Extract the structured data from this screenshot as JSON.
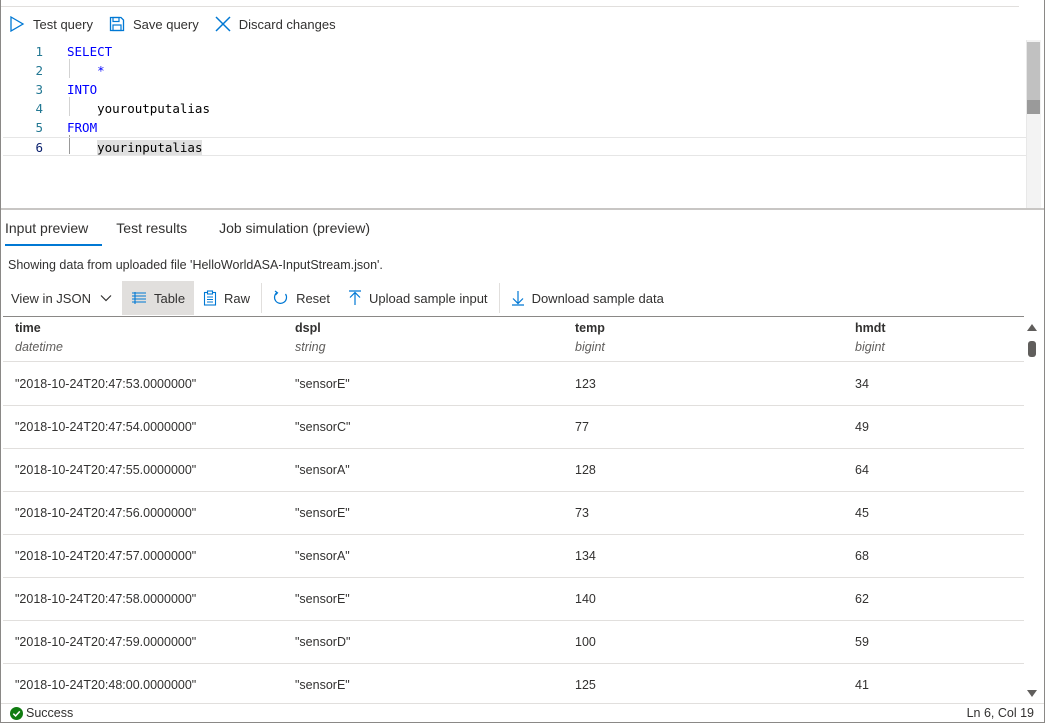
{
  "toolbar": {
    "test_query": "Test query",
    "save_query": "Save query",
    "discard_changes": "Discard changes"
  },
  "editor": {
    "lines": [
      {
        "num": "1",
        "text": "SELECT"
      },
      {
        "num": "2",
        "text": "    *"
      },
      {
        "num": "3",
        "text": "INTO"
      },
      {
        "num": "4",
        "text": "    youroutputalias"
      },
      {
        "num": "5",
        "text": "FROM"
      },
      {
        "num": "6",
        "text": "    yourinputalias"
      }
    ],
    "colors": {
      "keyword": "#0000ff",
      "line_number": "#237893"
    }
  },
  "tabs": [
    {
      "label": "Input preview",
      "active": true
    },
    {
      "label": "Test results",
      "active": false
    },
    {
      "label": "Job simulation (preview)",
      "active": false
    }
  ],
  "info_text": "Showing data from uploaded file 'HelloWorldASA-InputStream.json'.",
  "table_toolbar": {
    "view_select": "View in JSON",
    "table": "Table",
    "raw": "Raw",
    "reset": "Reset",
    "upload": "Upload sample input",
    "download": "Download sample data"
  },
  "grid": {
    "columns": [
      {
        "name": "time",
        "type": "datetime"
      },
      {
        "name": "dspl",
        "type": "string"
      },
      {
        "name": "temp",
        "type": "bigint"
      },
      {
        "name": "hmdt",
        "type": "bigint"
      }
    ],
    "rows": [
      [
        "\"2018-10-24T20:47:53.0000000\"",
        "\"sensorE\"",
        "123",
        "34"
      ],
      [
        "\"2018-10-24T20:47:54.0000000\"",
        "\"sensorC\"",
        "77",
        "49"
      ],
      [
        "\"2018-10-24T20:47:55.0000000\"",
        "\"sensorA\"",
        "128",
        "64"
      ],
      [
        "\"2018-10-24T20:47:56.0000000\"",
        "\"sensorE\"",
        "73",
        "45"
      ],
      [
        "\"2018-10-24T20:47:57.0000000\"",
        "\"sensorA\"",
        "134",
        "68"
      ],
      [
        "\"2018-10-24T20:47:58.0000000\"",
        "\"sensorE\"",
        "140",
        "62"
      ],
      [
        "\"2018-10-24T20:47:59.0000000\"",
        "\"sensorD\"",
        "100",
        "59"
      ],
      [
        "\"2018-10-24T20:48:00.0000000\"",
        "\"sensorE\"",
        "125",
        "41"
      ]
    ]
  },
  "status": {
    "left": "Success",
    "right": "Ln 6, Col 19",
    "success_color": "#107c10"
  },
  "accent_color": "#0078d4"
}
